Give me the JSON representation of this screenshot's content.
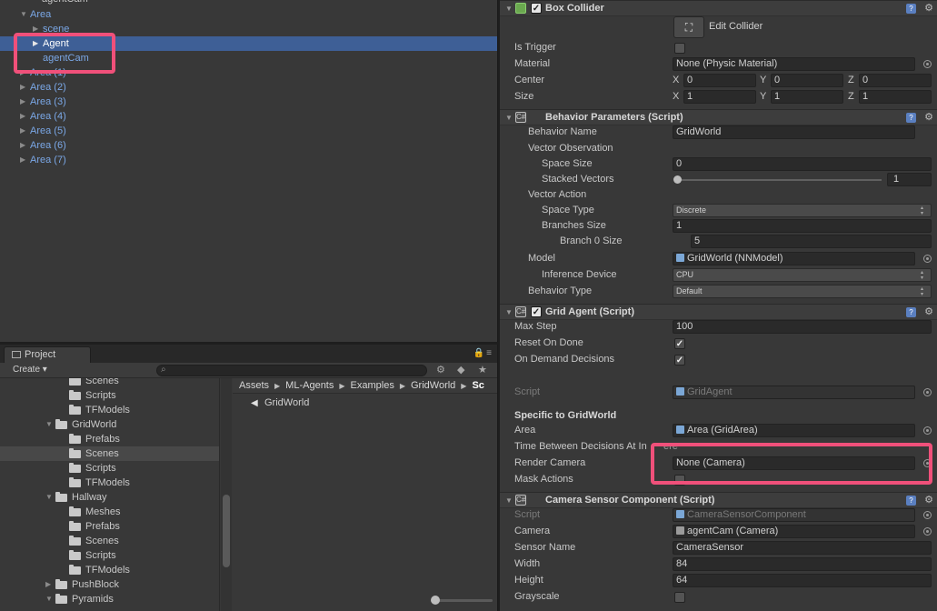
{
  "colors": {
    "selection": "#3e5f96",
    "highlight": "#f0507a",
    "prefab_text": "#7aa7e6",
    "background": "#383838"
  },
  "hierarchy": {
    "top_cut_label": "agentCam",
    "items": [
      {
        "label": "Area",
        "indent": 1,
        "arrow": "down",
        "prefab": true
      },
      {
        "label": "scene",
        "indent": 2,
        "arrow": "right",
        "prefab": true
      },
      {
        "label": "Agent",
        "indent": 2,
        "arrow": "right",
        "prefab": true,
        "selected": true
      },
      {
        "label": "agentCam",
        "indent": 2,
        "arrow": "",
        "prefab": true
      },
      {
        "label": "Area (1)",
        "indent": 1,
        "arrow": "right",
        "prefab": true
      },
      {
        "label": "Area (2)",
        "indent": 1,
        "arrow": "right",
        "prefab": true
      },
      {
        "label": "Area (3)",
        "indent": 1,
        "arrow": "right",
        "prefab": true
      },
      {
        "label": "Area (4)",
        "indent": 1,
        "arrow": "right",
        "prefab": true
      },
      {
        "label": "Area (5)",
        "indent": 1,
        "arrow": "right",
        "prefab": true
      },
      {
        "label": "Area (6)",
        "indent": 1,
        "arrow": "right",
        "prefab": true
      },
      {
        "label": "Area (7)",
        "indent": 1,
        "arrow": "right",
        "prefab": true
      }
    ]
  },
  "project": {
    "tab_label": "Project",
    "create_label": "Create ▾",
    "tree": [
      {
        "label": "Scenes",
        "indent": 3,
        "arrow": ""
      },
      {
        "label": "Scripts",
        "indent": 3,
        "arrow": ""
      },
      {
        "label": "TFModels",
        "indent": 3,
        "arrow": ""
      },
      {
        "label": "GridWorld",
        "indent": 2,
        "arrow": "down"
      },
      {
        "label": "Prefabs",
        "indent": 3,
        "arrow": ""
      },
      {
        "label": "Scenes",
        "indent": 3,
        "arrow": "",
        "selected": true
      },
      {
        "label": "Scripts",
        "indent": 3,
        "arrow": ""
      },
      {
        "label": "TFModels",
        "indent": 3,
        "arrow": ""
      },
      {
        "label": "Hallway",
        "indent": 2,
        "arrow": "down"
      },
      {
        "label": "Meshes",
        "indent": 3,
        "arrow": ""
      },
      {
        "label": "Prefabs",
        "indent": 3,
        "arrow": ""
      },
      {
        "label": "Scenes",
        "indent": 3,
        "arrow": ""
      },
      {
        "label": "Scripts",
        "indent": 3,
        "arrow": ""
      },
      {
        "label": "TFModels",
        "indent": 3,
        "arrow": ""
      },
      {
        "label": "PushBlock",
        "indent": 2,
        "arrow": "right"
      },
      {
        "label": "Pyramids",
        "indent": 2,
        "arrow": "down"
      }
    ],
    "breadcrumb": [
      "Assets",
      "ML-Agents",
      "Examples",
      "GridWorld",
      "Sc"
    ],
    "asset_item": "GridWorld"
  },
  "inspector": {
    "box_collider": {
      "title": "Box Collider",
      "edit_collider": "Edit Collider",
      "is_trigger": "Is Trigger",
      "material_label": "Material",
      "material_value": "None (Physic Material)",
      "center_label": "Center",
      "center": {
        "x": "0",
        "y": "0",
        "z": "0"
      },
      "size_label": "Size",
      "size": {
        "x": "1",
        "y": "1",
        "z": "1"
      },
      "axis_x": "X",
      "axis_y": "Y",
      "axis_z": "Z"
    },
    "behavior_parameters": {
      "title": "Behavior Parameters (Script)",
      "behavior_name_label": "Behavior Name",
      "behavior_name": "GridWorld",
      "vector_observation": "Vector Observation",
      "space_size_label": "Space Size",
      "space_size": "0",
      "stacked_vectors_label": "Stacked Vectors",
      "stacked_vectors": "1",
      "vector_action": "Vector Action",
      "space_type_label": "Space Type",
      "space_type": "Discrete",
      "branches_size_label": "Branches Size",
      "branches_size": "1",
      "branch0_label": "Branch 0 Size",
      "branch0": "5",
      "model_label": "Model",
      "model": "GridWorld (NNModel)",
      "inference_device_label": "Inference Device",
      "inference_device": "CPU",
      "behavior_type_label": "Behavior Type",
      "behavior_type": "Default"
    },
    "grid_agent": {
      "title": "Grid Agent (Script)",
      "max_step_label": "Max Step",
      "max_step": "100",
      "reset_on_done": "Reset On Done",
      "on_demand": "On Demand Decisions",
      "script_label": "Script",
      "script": "GridAgent",
      "specific_label": "Specific to GridWorld",
      "area_label": "Area",
      "area": "Area (GridArea)",
      "time_between_label": "Time Between Decisions At In",
      "time_between_suffix": "ere",
      "render_camera_label": "Render Camera",
      "render_camera": "None (Camera)",
      "mask_actions": "Mask Actions"
    },
    "camera_sensor": {
      "title": "Camera Sensor Component (Script)",
      "script_label": "Script",
      "script": "CameraSensorComponent",
      "camera_label": "Camera",
      "camera": "agentCam (Camera)",
      "sensor_name_label": "Sensor Name",
      "sensor_name": "CameraSensor",
      "width_label": "Width",
      "width": "84",
      "height_label": "Height",
      "height": "64",
      "grayscale": "Grayscale"
    }
  }
}
